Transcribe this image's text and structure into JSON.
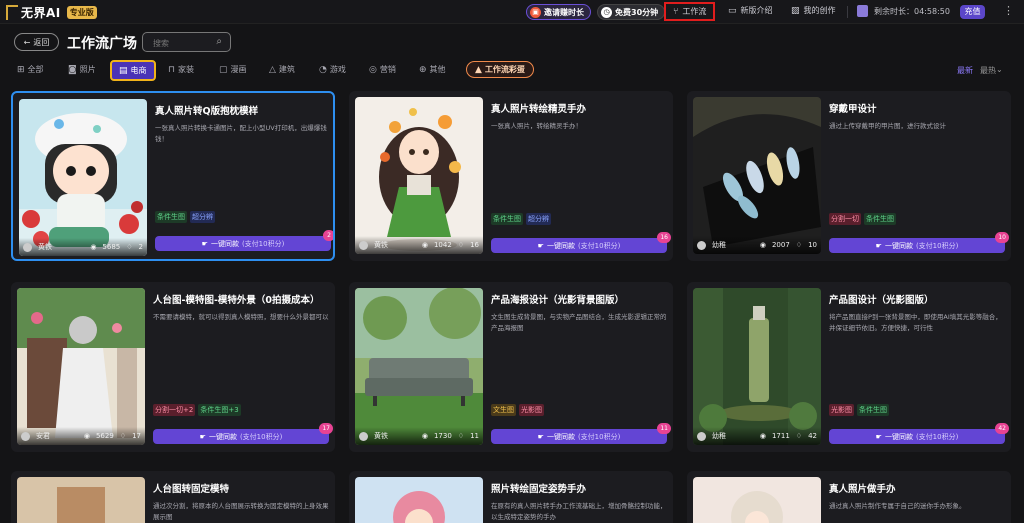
{
  "app": {
    "brand": "无界AI",
    "edition": "专业版"
  },
  "header": {
    "invite": "邀请赚时长",
    "free": "免费30分钟",
    "workflow": "工作流",
    "newbie": "新版介绍",
    "my_works": "我的创作",
    "remaining": "剩余时长：04:58:50",
    "recharge": "充值"
  },
  "page": {
    "back": "返回",
    "title": "工作流广场",
    "search_placeholder": "搜索"
  },
  "categories": [
    {
      "label": "全部",
      "icon": "grid-icon"
    },
    {
      "label": "照片",
      "icon": "camera-icon"
    },
    {
      "label": "电商",
      "icon": "shop-icon",
      "active": true
    },
    {
      "label": "家装",
      "icon": "sofa-icon"
    },
    {
      "label": "漫画",
      "icon": "comic-icon"
    },
    {
      "label": "建筑",
      "icon": "building-icon"
    },
    {
      "label": "游戏",
      "icon": "gamepad-icon"
    },
    {
      "label": "营销",
      "icon": "megaphone-icon"
    },
    {
      "label": "其他",
      "icon": "more-icon"
    },
    {
      "label": "工作流彩蛋",
      "icon": "fire-icon",
      "hot": true
    }
  ],
  "sort": {
    "latest": "最新",
    "hottest": "最热"
  },
  "cards": [
    {
      "title": "真人照片转Q版抱枕模样",
      "desc": "一张真人照片转换卡通图片，配上小型UV打印机，出爆爆钱钱！",
      "tags": [
        {
          "t": "条件生图",
          "c": "green"
        },
        {
          "t": "超分辨",
          "c": "blue"
        }
      ],
      "author": "黄铁",
      "views": "5685",
      "likes": "2",
      "badge": "2",
      "btn": "一键同款",
      "cost": "(支付10积分)"
    },
    {
      "title": "真人照片转绘精灵手办",
      "desc": "一张真人照片，转绘精灵手办！",
      "tags": [
        {
          "t": "条件生图",
          "c": "green"
        },
        {
          "t": "超分辨",
          "c": "blue"
        }
      ],
      "author": "黄铁",
      "views": "1042",
      "likes": "16",
      "badge": "16",
      "btn": "一键同款",
      "cost": "(支付10积分)"
    },
    {
      "title": "穿戴甲设计",
      "desc": "通过上传穿戴甲的甲片图，进行款式设计",
      "tags": [
        {
          "t": "分割一切",
          "c": "pink"
        },
        {
          "t": "条件生图",
          "c": "green"
        }
      ],
      "author": "幼稚",
      "views": "2007",
      "likes": "10",
      "badge": "10",
      "btn": "一键同款",
      "cost": "(支付10积分)"
    },
    {
      "title": "人台图-模特图-模特外景（0拍摄成本）",
      "desc": "不需要请模特，就可以得到真人模特照，想要什么外景都可以",
      "tags": [
        {
          "t": "分割一切+2",
          "c": "pink"
        },
        {
          "t": "条件生图+3",
          "c": "green"
        }
      ],
      "author": "安君",
      "views": "5629",
      "likes": "17",
      "badge": "17",
      "btn": "一键同款",
      "cost": "(支付10积分)"
    },
    {
      "title": "产品海报设计（光影背景图版）",
      "desc": "文生图生成背景图，与实物产品图结合，生成光影逻辑正常的产品海报图",
      "tags": [
        {
          "t": "文生图",
          "c": "gold"
        },
        {
          "t": "光影图",
          "c": "pink"
        }
      ],
      "author": "黄铁",
      "views": "1730",
      "likes": "11",
      "badge": "11",
      "btn": "一键同款",
      "cost": "(支付10积分)"
    },
    {
      "title": "产品图设计（光影图版）",
      "desc": "将产品图直接P到一张背景图中，即使用AI填其光影等融合，并保证细节依旧。方便快捷，可行性",
      "tags": [
        {
          "t": "光影图",
          "c": "pink"
        },
        {
          "t": "条件生图",
          "c": "green"
        }
      ],
      "author": "幼稚",
      "views": "1711",
      "likes": "42",
      "badge": "42",
      "btn": "一键同款",
      "cost": "(支付10积分)"
    },
    {
      "title": "人台图转固定模特",
      "desc": "通过次分割，将原本的人台图展示转换为固定模特的上身效果展示图",
      "tags": [],
      "author": "",
      "views": "",
      "likes": "",
      "badge": "",
      "btn": "",
      "cost": ""
    },
    {
      "title": "照片转绘固定姿势手办",
      "desc": "在原有的真人照片转手办工作流基础上，增加骨骼控制功能，以生成特定姿势的手办",
      "tags": [],
      "author": "",
      "views": "",
      "likes": "",
      "badge": "",
      "btn": "",
      "cost": ""
    },
    {
      "title": "真人照片做手办",
      "desc": "通过真人照片制作专属于自己的迷你手办形象。",
      "tags": [],
      "author": "",
      "views": "",
      "likes": "",
      "badge": "",
      "btn": "",
      "cost": ""
    }
  ]
}
